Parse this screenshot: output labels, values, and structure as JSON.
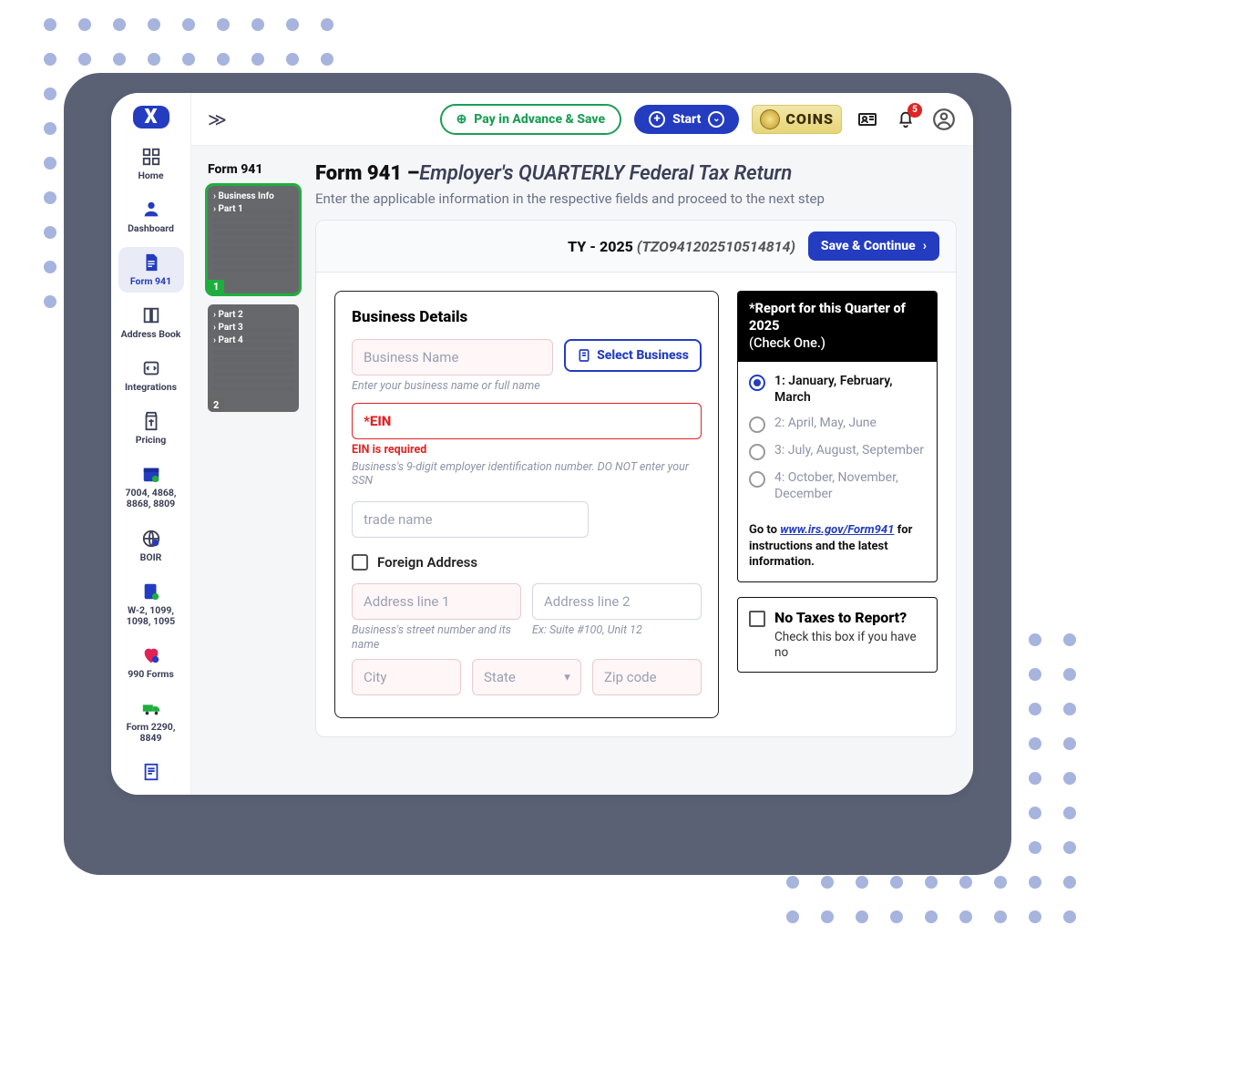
{
  "sidebar": {
    "items": [
      {
        "label": "Home"
      },
      {
        "label": "Dashboard"
      },
      {
        "label": "Form 941"
      },
      {
        "label": "Address Book"
      },
      {
        "label": "Integrations"
      },
      {
        "label": "Pricing"
      },
      {
        "label": "7004, 4868, 8868, 8809"
      },
      {
        "label": "BOIR"
      },
      {
        "label": "W-2, 1099, 1098, 1095"
      },
      {
        "label": "990 Forms"
      },
      {
        "label": "Form 2290, 8849"
      }
    ]
  },
  "topbar": {
    "pay_label": "Pay in Advance & Save",
    "start_label": "Start",
    "coins_label": "COINS",
    "notif_count": "5"
  },
  "thumbs": {
    "title": "Form 941",
    "page1": {
      "lines": [
        "Business Info",
        "Part 1"
      ],
      "num": "1"
    },
    "page2": {
      "lines": [
        "Part 2",
        "Part 3",
        "Part 4"
      ],
      "num": "2"
    }
  },
  "page": {
    "title_bold": "Form 941 –",
    "title_italic": "Employer's QUARTERLY Federal Tax Return",
    "subtitle": "Enter the applicable information in the respective fields and proceed to the next step",
    "ty_label": "TY - 2025",
    "ty_id": "(TZO941202510514814)",
    "save_label": "Save & Continue"
  },
  "form": {
    "section": "Business Details",
    "business_ph": "Business Name",
    "business_hint": "Enter your business name or full name",
    "select_biz": "Select Business",
    "ein_label": "*EIN",
    "ein_err": "EIN is required",
    "ein_hint": "Business's 9-digit employer identification number. DO NOT enter your SSN",
    "trade_ph": "trade name",
    "foreign_label": "Foreign Address",
    "addr1_ph": "Address line 1",
    "addr1_hint": "Business's street number and its name",
    "addr2_ph": "Address line 2",
    "addr2_hint": "Ex: Suite #100, Unit 12",
    "city_ph": "City",
    "state_ph": "State",
    "zip_ph": "Zip code"
  },
  "quarter": {
    "head1": "*Report for this Quarter of 2025",
    "head2": "(Check One.)",
    "opts": [
      "1: January, February, March",
      "2: April, May, June",
      "3: July, August, September",
      "4: October, November, December"
    ],
    "foot_pre": "Go to ",
    "foot_link": "www.irs.gov/Form941",
    "foot_post": " for instructions and the latest information."
  },
  "notax": {
    "title": "No Taxes to Report?",
    "sub": "Check this box if you have no"
  }
}
